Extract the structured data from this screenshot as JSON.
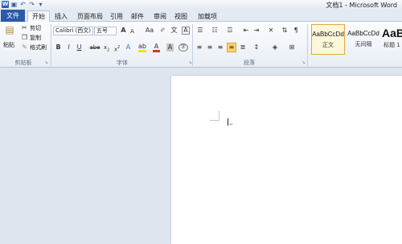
{
  "title_bar": {
    "title": "文档1 - Microsoft Word",
    "app_icon": "word-icon",
    "quick_access": [
      "save-icon",
      "undo-icon",
      "redo-icon",
      "customize-icon"
    ]
  },
  "tabs": {
    "file": "文件",
    "items": [
      "开始",
      "插入",
      "页面布局",
      "引用",
      "邮件",
      "审阅",
      "视图",
      "加载项"
    ],
    "active": "开始"
  },
  "clipboard": {
    "paste": "粘贴",
    "cut": "剪切",
    "copy": "复制",
    "format_painter": "格式刷",
    "label": "剪贴板"
  },
  "font": {
    "name": "Calibri (西文)",
    "size": "五号",
    "label": "字体",
    "grow": "A",
    "shrink": "A",
    "change_case": "Aa",
    "bold": "B",
    "italic": "I",
    "underline": "U",
    "strike": "abe",
    "sub": "x",
    "sup": "x"
  },
  "paragraph": {
    "label": "段落"
  },
  "styles": {
    "items": [
      {
        "sample": "AaBbCcDd",
        "name": "正文"
      },
      {
        "sample": "AaBbCcDd",
        "name": "无间隔"
      },
      {
        "sample": "AaB",
        "name": "标题 1"
      }
    ]
  },
  "colors": {
    "accent": "#2a5aa8",
    "page": "#ffffff",
    "workspace": "#dfe5ee"
  }
}
